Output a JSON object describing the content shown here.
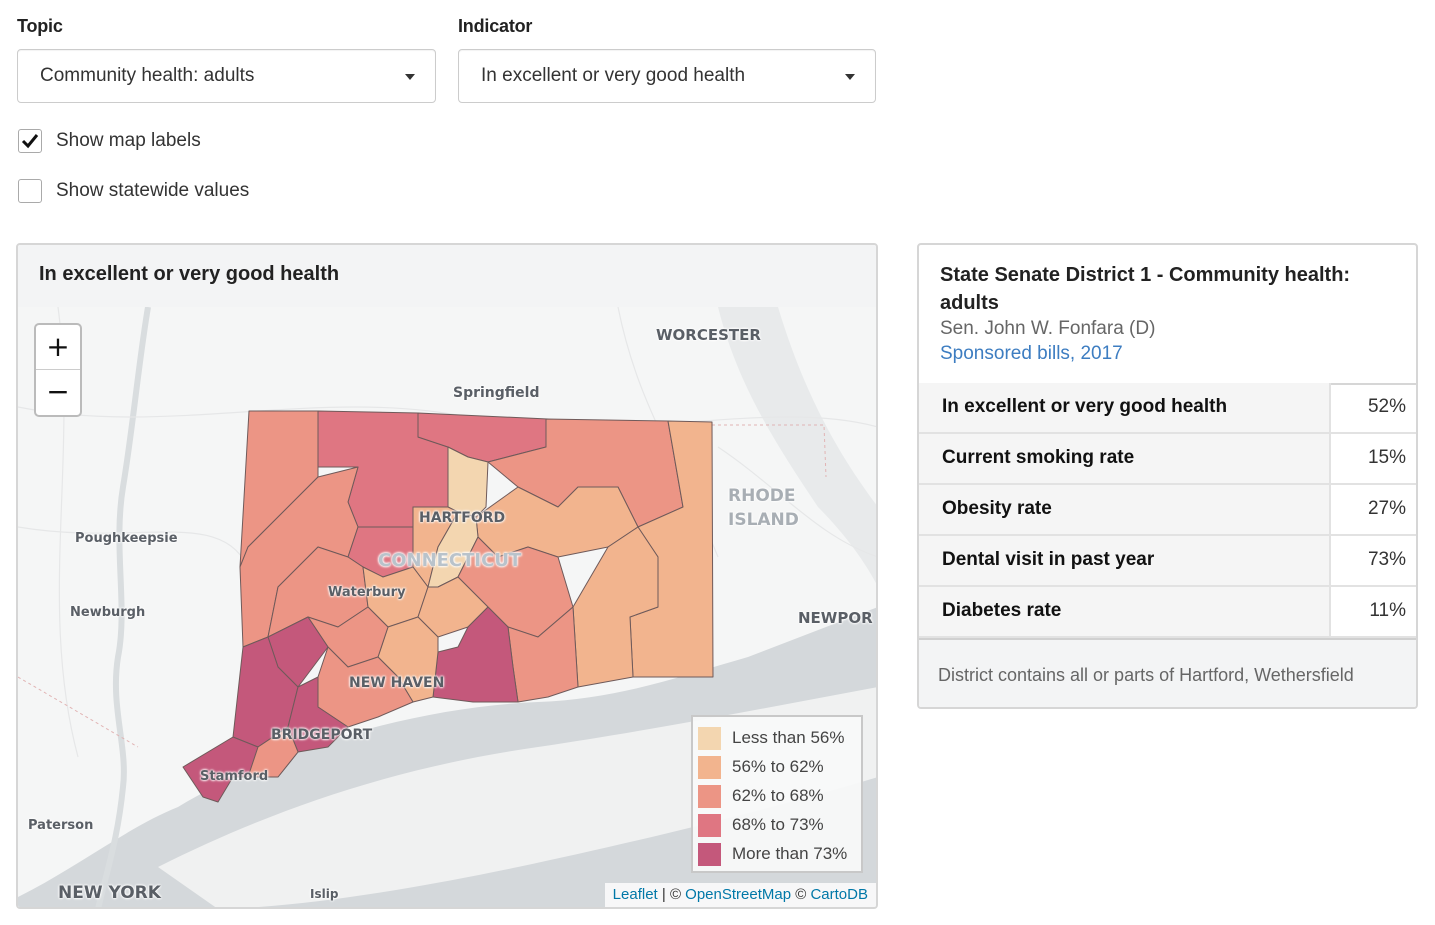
{
  "filters": {
    "topic": {
      "label": "Topic",
      "value": "Community health: adults"
    },
    "indicator": {
      "label": "Indicator",
      "value": "In excellent or very good health"
    }
  },
  "options": {
    "show_map_labels": {
      "label": "Show map labels",
      "checked": true
    },
    "show_statewide": {
      "label": "Show statewide values",
      "checked": false
    }
  },
  "map": {
    "title": "In excellent or very good health",
    "zoom_in": "+",
    "zoom_out": "−",
    "place_labels": {
      "worcester": "WORCESTER",
      "springfield": "Springfield",
      "rhode1": "RHODE",
      "rhode2": "ISLAND",
      "hartford": "HARTFORD",
      "connecticut": "CONNECTICUT",
      "poughkeepsie": "Poughkeepsie",
      "waterbury": "Waterbury",
      "newburgh": "Newburgh",
      "newport": "NEWPOR",
      "new_haven": "NEW HAVEN",
      "bridgeport": "BRIDGEPORT",
      "stamford": "Stamford",
      "paterson": "Paterson",
      "new_york": "NEW YORK",
      "islip": "Islip"
    },
    "legend": [
      {
        "label": "Less than 56%",
        "color": "#f3d6b0"
      },
      {
        "label": "56% to 62%",
        "color": "#f2b48e"
      },
      {
        "label": "62% to 68%",
        "color": "#ec9585"
      },
      {
        "label": "68% to 73%",
        "color": "#df7682"
      },
      {
        "label": "More than 73%",
        "color": "#c4587b"
      }
    ],
    "attribution": {
      "leaflet": "Leaflet",
      "sep": " | © ",
      "osm": "OpenStreetMap",
      "sep2": " © ",
      "carto": "CartoDB"
    }
  },
  "info": {
    "title": "State Senate District 1 - Community health: adults",
    "senator": "Sen. John W. Fonfara (D)",
    "link": "Sponsored bills, 2017",
    "rows": [
      {
        "label": "In excellent or very good health",
        "value": "52%"
      },
      {
        "label": "Current smoking rate",
        "value": "15%"
      },
      {
        "label": "Obesity rate",
        "value": "27%"
      },
      {
        "label": "Dental visit in past year",
        "value": "73%"
      },
      {
        "label": "Diabetes rate",
        "value": "11%"
      }
    ],
    "footer": "District contains all or parts of Hartford, Wethersfield"
  }
}
